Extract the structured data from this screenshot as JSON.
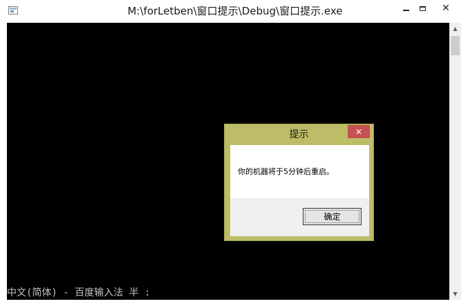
{
  "window": {
    "title": "M:\\forLetben\\窗口提示\\Debug\\窗口提示.exe",
    "icon": "console-app-icon",
    "controls": {
      "minimize": "minimize-icon",
      "maximize": "maximize-icon",
      "close": "✕"
    }
  },
  "console": {
    "background": "#000000",
    "ime_status": "中文(简体) - 百度输入法 半 :"
  },
  "scrollbar": {
    "up": "▲",
    "down": "▼"
  },
  "dialog": {
    "title": "提示",
    "close_label": "✕",
    "message": "你的机器将于5分钟后重启。",
    "ok_label": "确定",
    "frame_color": "#bdbd67",
    "close_color": "#c75050"
  }
}
